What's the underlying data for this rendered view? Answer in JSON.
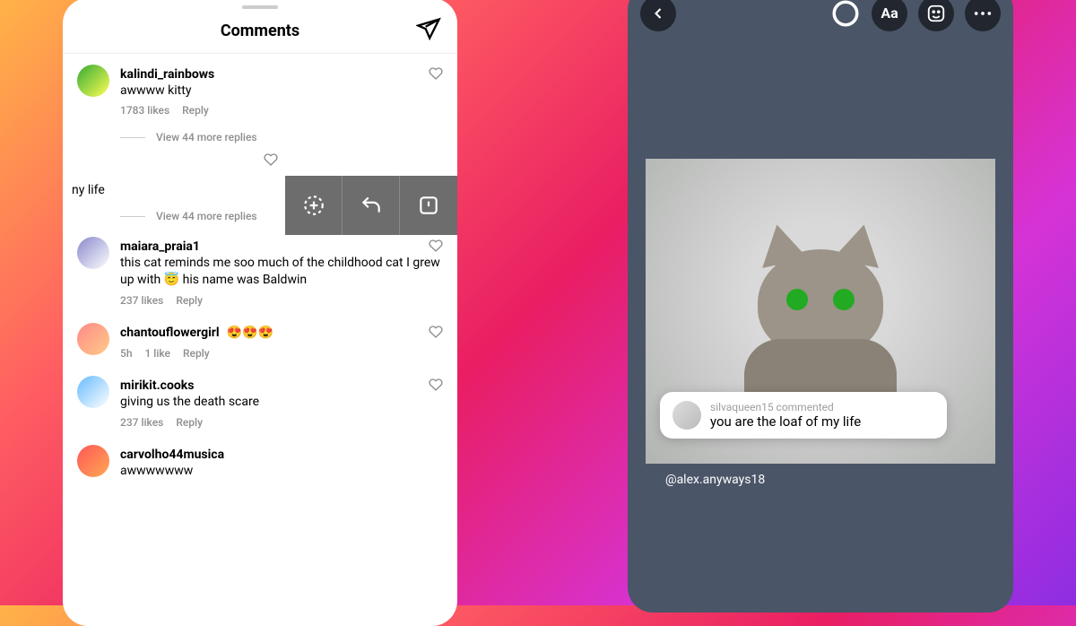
{
  "left": {
    "title": "Comments",
    "partial_text": "ny life",
    "comments": [
      {
        "user": "kalindi_rainbows",
        "text": "awwww kitty",
        "likes": "1783 likes",
        "reply": "Reply",
        "more": "View 44 more replies"
      },
      {
        "user": "maiara_praia1",
        "text": "this cat reminds me soo much of the childhood cat I grew up with 😇 his name was Baldwin",
        "likes": "237 likes",
        "reply": "Reply",
        "time": ""
      },
      {
        "user": "chantouflowergirl",
        "text": "😍😍😍",
        "likes": "1 like",
        "reply": "Reply",
        "time": "5h"
      },
      {
        "user": "mirikit.cooks",
        "text": "giving us the death scare",
        "likes": "237 likes",
        "reply": "Reply",
        "time": ""
      },
      {
        "user": "carvolho44musica",
        "text": "awwwwwww",
        "likes": "",
        "reply": "",
        "time": ""
      }
    ],
    "more_replies_2": "View 44 more replies"
  },
  "right": {
    "commenter": "silvaqueen15 commented",
    "comment": "you are the loaf of my life",
    "mention": "@alex.anyways18"
  }
}
